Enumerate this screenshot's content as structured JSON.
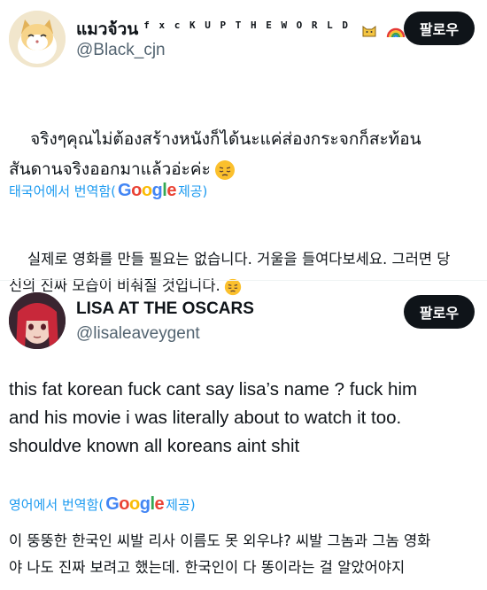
{
  "tweet1": {
    "display_name": "แมวจ้วน",
    "wordmark": "f x c K  U P  T H E  W O R L D",
    "handle": "@Black_cjn",
    "follow_label": "팔로우",
    "text": "จริงๆคุณไม่ต้องสร้างหนังก็ได้นะแค่ส่องกระจกก็สะท้อน\nสันดานจริงออกมาแล้วอ่ะค่ะ",
    "translate_prefix": "태국어에서 번역함(",
    "google_word": "Google",
    "translate_suffix": " 제공)",
    "translation": "실제로 영화를 만들 필요는 없습니다. 거울을 들여다보세요. 그러면 당\n신의 진짜 모습이 비춰질 것입니다."
  },
  "tweet2": {
    "display_name": "LISA AT THE OSCARS",
    "handle": "@lisaleaveygent",
    "follow_label": "팔로우",
    "text": "this fat korean fuck cant say lisa’s name ? fuck him\nand his movie i was literally about to watch it too.\nshouldve known all koreans aint shit",
    "translate_prefix": "영어에서 번역함(",
    "google_word": "Google",
    "translate_suffix": " 제공)",
    "translation": "이 뚱뚱한 한국인 씨발 리사 이름도 못 외우냐? 씨발 그놈과 그놈 영화\n야 나도 진짜 보려고 했는데. 한국인이 다 똥이라는 걸 알았어야지"
  },
  "colors": {
    "link_blue": "#1d9bf0",
    "handle_gray": "#536471",
    "button_black": "#0f1419"
  },
  "icons": [
    "cat-emoji",
    "rainbow-emoji",
    "pensive-face-emoji"
  ]
}
